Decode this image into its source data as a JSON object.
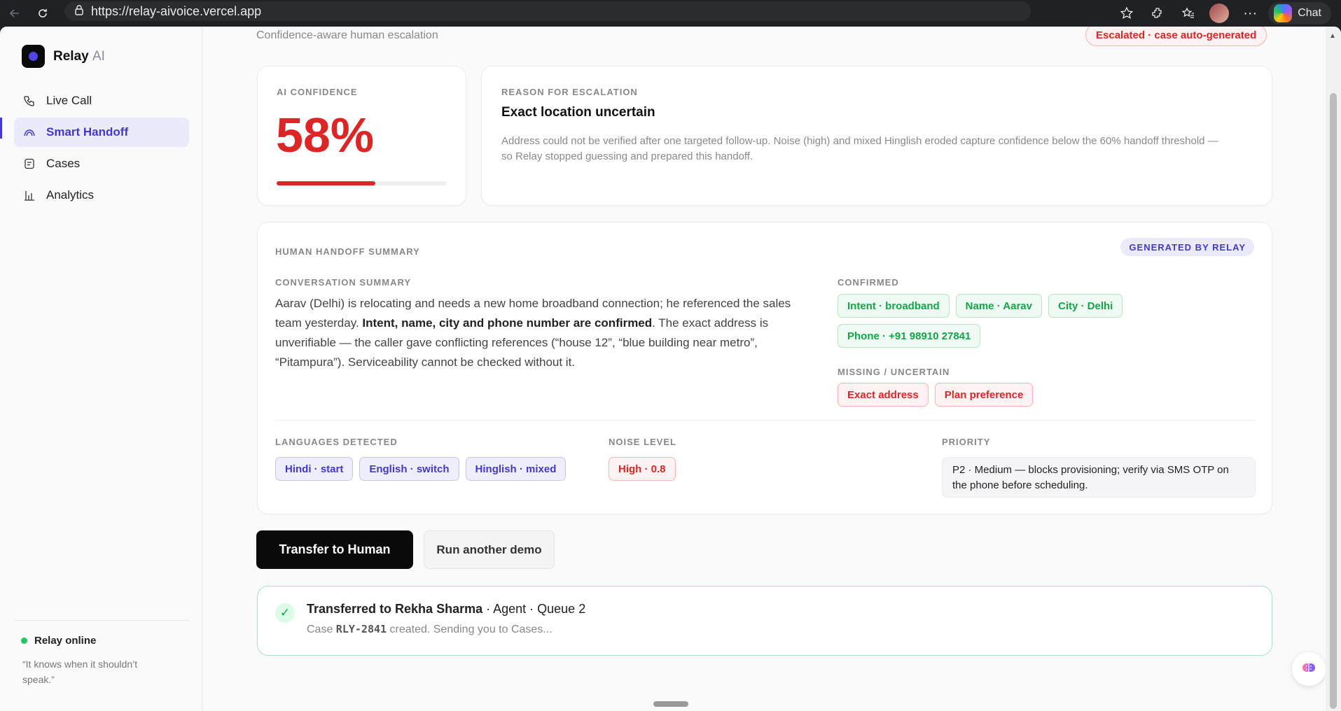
{
  "browser": {
    "url": "https://relay-aivoice.vercel.app",
    "chat_label": "Chat"
  },
  "sidebar": {
    "brand_name": "Relay",
    "brand_suffix": "AI",
    "items": [
      {
        "label": "Live Call",
        "icon": "phone-icon"
      },
      {
        "label": "Smart Handoff",
        "icon": "handoff-icon",
        "active": true
      },
      {
        "label": "Cases",
        "icon": "case-icon"
      },
      {
        "label": "Analytics",
        "icon": "chart-icon"
      }
    ],
    "status": "Relay online",
    "tagline": "“It knows when it shouldn’t speak.”"
  },
  "header": {
    "subtitle": "Confidence-aware human escalation",
    "escalation_badge": "Escalated · case auto-generated"
  },
  "confidence": {
    "label": "AI CONFIDENCE",
    "value": "58%",
    "fraction": 0.58
  },
  "reason": {
    "label": "REASON FOR ESCALATION",
    "title": "Exact location uncertain",
    "text": "Address could not be verified after one targeted follow-up. Noise (high) and mixed Hinglish eroded capture confidence below the 60% handoff threshold — so Relay stopped guessing and prepared this handoff."
  },
  "summary": {
    "header": "HUMAN HANDOFF SUMMARY",
    "generated_badge": "GENERATED BY RELAY",
    "conversation_label": "CONVERSATION SUMMARY",
    "conversation_pre": "Aarav (Delhi) is relocating and needs a new home broadband connection; he referenced the sales team yesterday. ",
    "conversation_bold": "Intent, name, city and phone number are confirmed",
    "conversation_post": ". The exact address is unverifiable — the caller gave conflicting references (“house 12”, “blue building near metro”, “Pitampura”). Serviceability cannot be checked without it.",
    "confirmed_label": "CONFIRMED",
    "confirmed": [
      "Intent · broadband",
      "Name · Aarav",
      "City · Delhi",
      "Phone · +91 98910 27841"
    ],
    "missing_label": "MISSING / UNCERTAIN",
    "missing": [
      "Exact address",
      "Plan preference"
    ],
    "languages_label": "LANGUAGES DETECTED",
    "languages": [
      "Hindi · start",
      "English · switch",
      "Hinglish · mixed"
    ],
    "noise_label": "NOISE LEVEL",
    "noise": "High · 0.8",
    "priority_label": "PRIORITY",
    "priority": "P2 · Medium — blocks provisioning; verify via SMS OTP on the phone before scheduling."
  },
  "actions": {
    "primary": "Transfer to Human",
    "secondary": "Run another demo"
  },
  "transfer": {
    "name": "Transferred to Rekha Sharma",
    "role": " · Agent · Queue 2",
    "case_pre": "Case ",
    "case_id": "RLY-2841",
    "case_post": " created. Sending you to Cases..."
  },
  "colors": {
    "accent": "#4338ca",
    "danger": "#dc2626",
    "success": "#16a34a"
  }
}
